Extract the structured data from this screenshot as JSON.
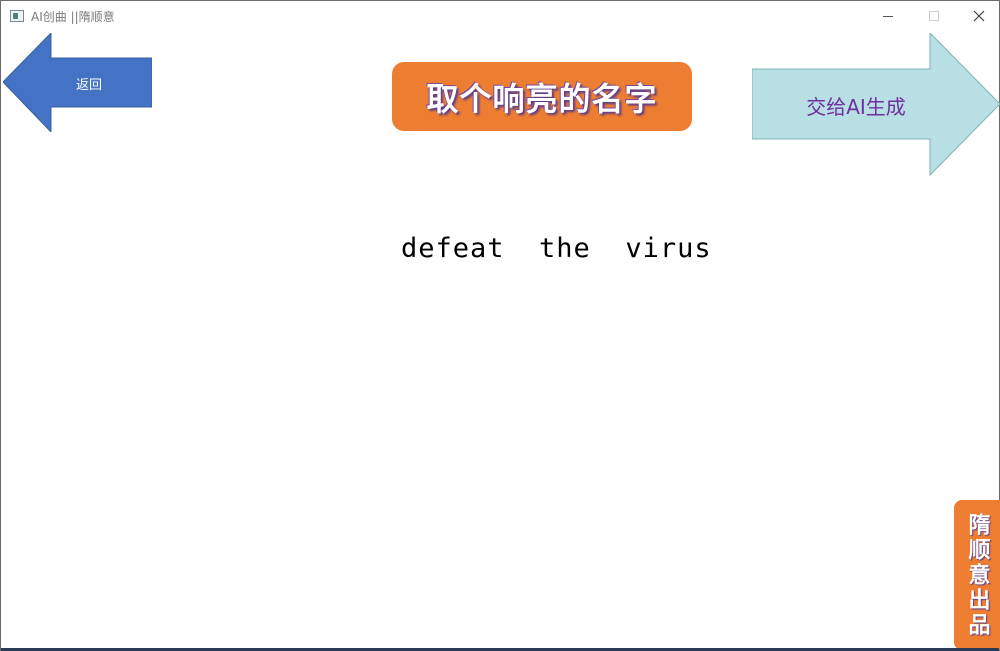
{
  "window": {
    "title": "AI创曲 ||隋顺意",
    "controls": {
      "minimize": "—",
      "maximize": "☐",
      "close": "✕"
    }
  },
  "toolbar": {
    "back_label": "返回",
    "page_heading": "取个响亮的名字",
    "generate_label": "交给AI生成"
  },
  "main": {
    "song_name": "defeat  the  virus"
  },
  "footer": {
    "credit": "隋顺意出品"
  },
  "colors": {
    "back_arrow": "#4472c4",
    "title_bg": "#ed7d31",
    "generate_arrow": "#b8dfe3",
    "generate_text": "#7030a0",
    "credit_bg": "#ed7d31"
  },
  "icons": {
    "back": "left-arrow-icon",
    "generate": "right-arrow-icon"
  }
}
